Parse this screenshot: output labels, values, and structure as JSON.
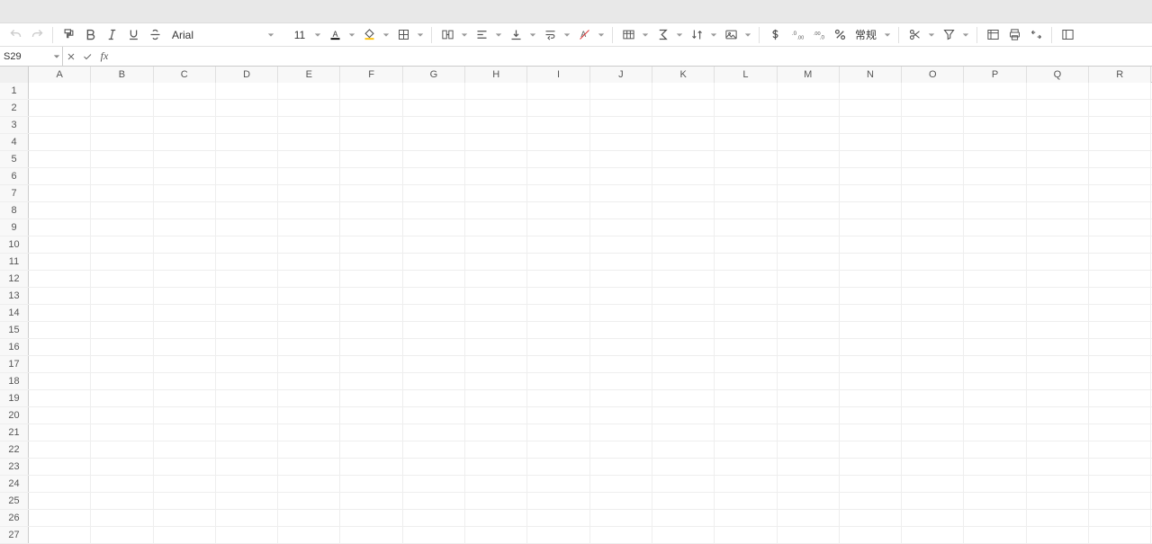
{
  "toolbar": {
    "font_name": "Arial",
    "font_size": "11",
    "number_format": "常规"
  },
  "formula_bar": {
    "cell_ref": "S29",
    "fx_label": "fx",
    "value": ""
  },
  "columns": [
    "A",
    "B",
    "C",
    "D",
    "E",
    "F",
    "G",
    "H",
    "I",
    "J",
    "K",
    "L",
    "M",
    "N",
    "O",
    "P",
    "Q",
    "R"
  ],
  "rows": [
    "1",
    "2",
    "3",
    "4",
    "5",
    "6",
    "7",
    "8",
    "9",
    "10",
    "11",
    "12",
    "13",
    "14",
    "15",
    "16",
    "17",
    "18",
    "19",
    "20",
    "21",
    "22",
    "23",
    "24",
    "25",
    "26",
    "27"
  ]
}
